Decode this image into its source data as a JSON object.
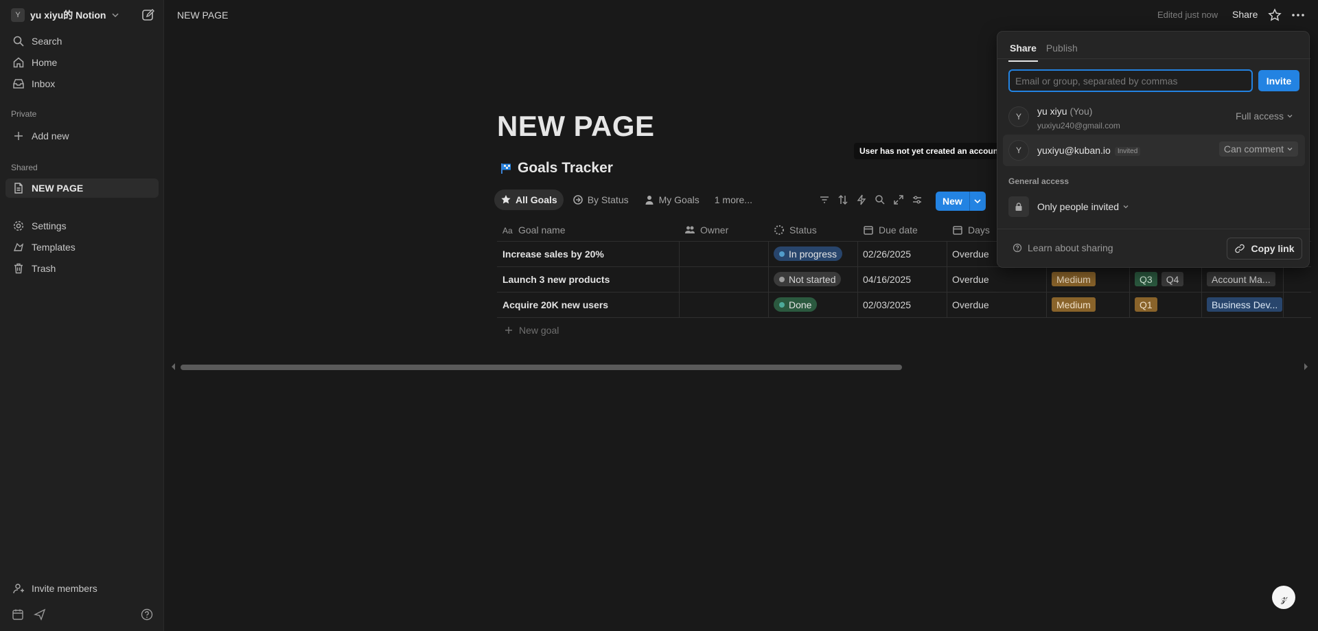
{
  "sidebar": {
    "workspace": {
      "avatar": "Y",
      "name": "yu xiyu的 Notion"
    },
    "nav": [
      {
        "label": "Search",
        "icon": "search-icon"
      },
      {
        "label": "Home",
        "icon": "home-icon"
      },
      {
        "label": "Inbox",
        "icon": "inbox-icon"
      }
    ],
    "private_label": "Private",
    "add_new": "Add new",
    "shared_label": "Shared",
    "shared_page": "NEW PAGE",
    "bottom_nav": [
      {
        "label": "Settings",
        "icon": "gear-icon"
      },
      {
        "label": "Templates",
        "icon": "templates-icon"
      },
      {
        "label": "Trash",
        "icon": "trash-icon"
      }
    ],
    "invite_members": "Invite members"
  },
  "topbar": {
    "title": "NEW PAGE",
    "edited": "Edited just now",
    "share": "Share"
  },
  "page": {
    "title": "NEW PAGE",
    "database_title": "Goals Tracker",
    "views": [
      "All Goals",
      "By Status",
      "My Goals",
      "1 more..."
    ],
    "new_button": "New",
    "columns": [
      "Goal name",
      "Owner",
      "Status",
      "Due date",
      "Days"
    ],
    "rows": [
      {
        "name": "Increase sales by 20%",
        "owner": "",
        "status": "In progress",
        "due": "02/26/2025",
        "days": "Overdue",
        "priority": "",
        "quarters": [],
        "team": ""
      },
      {
        "name": "Launch 3 new products",
        "owner": "",
        "status": "Not started",
        "due": "04/16/2025",
        "days": "Overdue",
        "priority": "Medium",
        "quarters": [
          "Q3",
          "Q4"
        ],
        "team": "Account Ma..."
      },
      {
        "name": "Acquire 20K new users",
        "owner": "",
        "status": "Done",
        "due": "02/03/2025",
        "days": "Overdue",
        "priority": "Medium",
        "quarters": [
          "Q1"
        ],
        "team": "Business Dev..."
      }
    ],
    "new_goal": "New goal"
  },
  "tooltip": "User has not yet created an account",
  "share_panel": {
    "tabs": [
      "Share",
      "Publish"
    ],
    "input_placeholder": "Email or group, separated by commas",
    "invite_button": "Invite",
    "members": [
      {
        "avatar": "Y",
        "name": "yu xiyu",
        "you": "(You)",
        "email": "yuxiyu240@gmail.com",
        "access": "Full access"
      },
      {
        "avatar": "Y",
        "name": "yuxiyu@kuban.io",
        "badge": "Invited",
        "access": "Can comment"
      }
    ],
    "general_access_label": "General access",
    "general_access_value": "Only people invited",
    "learn": "Learn about sharing",
    "copy_link": "Copy link"
  },
  "colors": {
    "accent": "#2383e2",
    "in_progress_bg": "#28456c",
    "in_progress_dot": "#529cca",
    "not_started_bg": "#3a3a3a",
    "not_started_dot": "#9b9b9b",
    "done_bg": "#2b593f",
    "done_dot": "#4dab9a",
    "medium_bg": "#89632a",
    "q3_bg": "#2b593f",
    "q4_bg": "#3a3a3a",
    "q1_bg": "#89632a",
    "account_bg": "#373737",
    "business_bg": "#28456c"
  }
}
